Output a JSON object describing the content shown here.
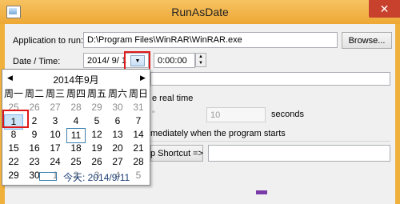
{
  "window": {
    "title": "RunAsDate",
    "close_symbol": "✕"
  },
  "form": {
    "app_label": "Application to run:",
    "app_value": "D:\\Program Files\\WinRAR\\WinRAR.exe",
    "browse_label": "Browse...",
    "datetime_label": "Date / Time:",
    "date_value": "2014/  9/  1",
    "time_value": "0:00:00",
    "real_time_label": "e real time",
    "seconds_label": "seconds",
    "seconds_value": "10",
    "immediately_label": "mediately when the program starts",
    "shortcut_label": "p Shortcut =>"
  },
  "calendar": {
    "month_title": "2014年9月",
    "prev_symbol": "◀",
    "next_symbol": "▶",
    "weekdays": [
      "周一",
      "周二",
      "周三",
      "周四",
      "周五",
      "周六",
      "周日"
    ],
    "rows": [
      [
        "25",
        "26",
        "27",
        "28",
        "29",
        "30",
        "31"
      ],
      [
        "1",
        "2",
        "3",
        "4",
        "5",
        "6",
        "7"
      ],
      [
        "8",
        "9",
        "10",
        "11",
        "12",
        "13",
        "14"
      ],
      [
        "15",
        "16",
        "17",
        "18",
        "19",
        "20",
        "21"
      ],
      [
        "22",
        "23",
        "24",
        "25",
        "26",
        "27",
        "28"
      ],
      [
        "29",
        "30",
        "1",
        "2",
        "3",
        "4",
        "5"
      ]
    ],
    "today_label": "今天: 2014/9/11"
  }
}
